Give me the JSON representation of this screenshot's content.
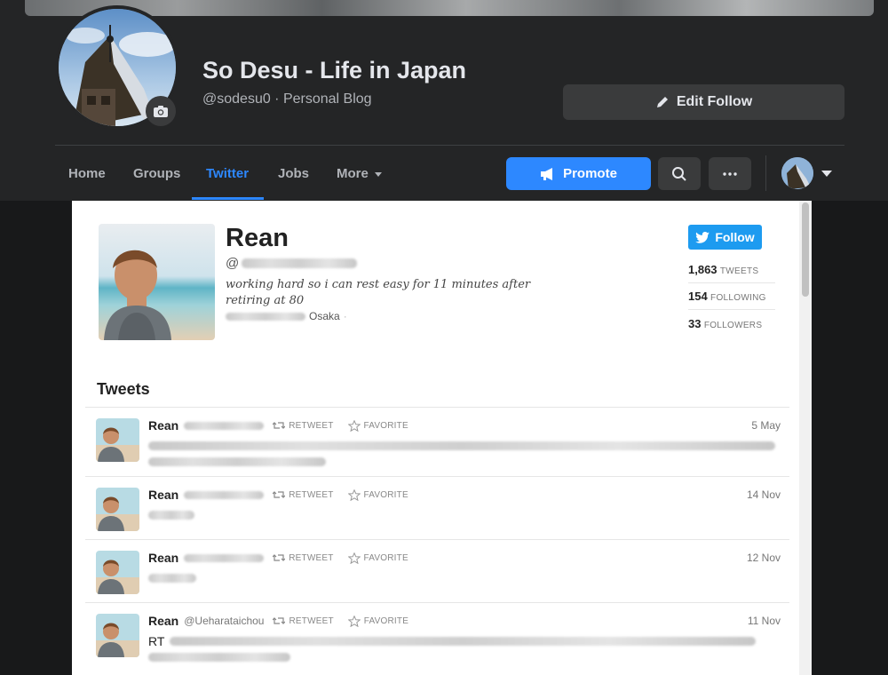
{
  "colors": {
    "fb_dark_bg": "#18191a",
    "fb_header_bg": "#242526",
    "fb_button_bg": "#3a3b3c",
    "fb_accent_blue": "#2d88ff",
    "twitter_blue": "#1d9bf0"
  },
  "page": {
    "title": "So Desu - Life in Japan",
    "subtitle": "@sodesu0 · Personal Blog",
    "edit_follow_label": "Edit Follow"
  },
  "nav": {
    "tabs": [
      {
        "label": "Home",
        "active": false
      },
      {
        "label": "Groups",
        "active": false
      },
      {
        "label": "Twitter",
        "active": true
      },
      {
        "label": "Jobs",
        "active": false
      },
      {
        "label": "More",
        "active": false
      }
    ],
    "promote_label": "Promote",
    "icons": [
      "search-icon",
      "more-dots-icon",
      "account-avatar",
      "chevron-down-icon"
    ]
  },
  "twitter": {
    "profile": {
      "name": "Rean",
      "handle_prefix": "@",
      "bio": "working hard so i can rest easy for 11 minutes after retiring at 80",
      "location": "Osaka",
      "follow_label": "Follow"
    },
    "stats": [
      {
        "value": "1,863",
        "label": "TWEETS"
      },
      {
        "value": "154",
        "label": "FOLLOWING"
      },
      {
        "value": "33",
        "label": "FOLLOWERS"
      }
    ],
    "tweets_title": "Tweets",
    "retweet_label": "RETWEET",
    "favorite_label": "FAVORITE",
    "tweets": [
      {
        "name": "Rean",
        "handle": "",
        "date": "5 May",
        "text": ""
      },
      {
        "name": "Rean",
        "handle": "",
        "date": "14 Nov",
        "text": ""
      },
      {
        "name": "Rean",
        "handle": "",
        "date": "12 Nov",
        "text": ""
      },
      {
        "name": "Rean",
        "handle": "@Ueharataichou",
        "date": "11 Nov",
        "text": "RT"
      }
    ]
  }
}
